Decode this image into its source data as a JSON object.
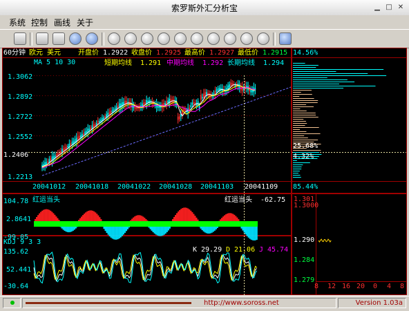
{
  "window": {
    "title": "索罗斯外汇分析宝",
    "minimize_glyph": "▁",
    "maximize_glyph": "□",
    "close_glyph": "✕"
  },
  "menu": {
    "items": [
      "系统",
      "控制",
      "画线",
      "关于"
    ]
  },
  "toolbar": {
    "icons": [
      "connect-icon",
      "list-icon",
      "chart-icon",
      "globe-icon",
      "clock-icon",
      "circle-a-icon",
      "circle-b-icon",
      "circle-c-icon",
      "circle-d-icon",
      "circle-e-icon",
      "circle-f-icon",
      "circle-g-icon",
      "circle-h-icon",
      "square-icon"
    ]
  },
  "header": {
    "period": "60分钟",
    "pair": "欧元 美元",
    "open_label": "开盘价",
    "open": "1.2922",
    "close_label": "收盘价",
    "close": "1.2925",
    "high_label": "最高价",
    "high": "1.2927",
    "low_label": "最低价",
    "low": "1.2915",
    "ma_label": "MA 5 10 30",
    "short_label": "短期均线",
    "short_value": "1.291",
    "mid_label": "中期均线",
    "mid_value": "1.292",
    "long_label": "长期均线",
    "long_value": "1.294"
  },
  "price_panel": {
    "y_ticks": [
      "1.3062",
      "1.2892",
      "1.2722",
      "1.2552",
      "1.2213"
    ],
    "cursor_price": "1.2406",
    "x_ticks": [
      "20041012",
      "20041018",
      "20041022",
      "20041028",
      "20041103"
    ],
    "cursor_date": "20041109",
    "colors": {
      "up": "#ff3030",
      "down": "#00ffff",
      "ma_short": "#ffffff",
      "ma_mid": "#ffff00",
      "ma_long": "#ff00ff",
      "trend": "#7070ff"
    }
  },
  "volume_profile": {
    "top_pct": "14.56%",
    "mid_pct1": "25.68%",
    "mid_pct2": "4.32%",
    "bottom_pct": "85.44%"
  },
  "hongyun": {
    "title": "红运当头",
    "right_label": "红运当头",
    "right_value": "-62.75",
    "y_ticks": [
      "104.78",
      "2.8641",
      "-99.05"
    ]
  },
  "kdj": {
    "title": "KDJ 9 3 3",
    "k_label": "K",
    "k_value": "29.29",
    "d_label": "D",
    "d_value": "21.06",
    "j_label": "J",
    "j_value": "45.74",
    "y_ticks": [
      "135.62",
      "52.441",
      "-30.64"
    ]
  },
  "mini_chart": {
    "y_ticks": [
      "1.301",
      "1.3000",
      "1.290",
      "1.284",
      "1.279"
    ],
    "x_ticks": [
      "8",
      "12",
      "16",
      "20",
      "0",
      "4",
      "8"
    ]
  },
  "statusbar": {
    "url": "http://www.soross.net",
    "version": "Version 1.03a"
  }
}
